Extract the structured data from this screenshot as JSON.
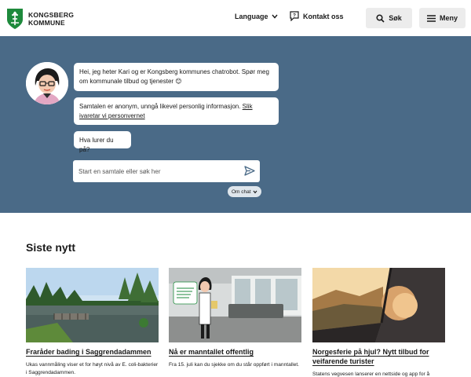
{
  "header": {
    "logo_line1": "KONGSBERG",
    "logo_line2": "KOMMUNE",
    "language": "Language",
    "contact": "Kontakt oss",
    "search": "Søk",
    "menu": "Meny"
  },
  "chat": {
    "bubble1": "Hei, jeg heter Kari og er Kongsberg kommunes chatrobot. Spør meg om kommunale tilbud og tjenester 😊",
    "bubble2_text": "Samtalen er anonym, unngå likevel personlig informasjon. ",
    "bubble2_link": "Slik ivaretar vi personvernet",
    "bubble3": "Hva lurer du på?",
    "input_placeholder": "Start en samtale eller søk her",
    "about": "Om chat"
  },
  "news": {
    "heading": "Siste nytt",
    "cards": [
      {
        "title": "Fraråder bading i Saggrendadammen",
        "text": "Ukas vannmåling viser et for høyt nivå av E. coli-bakterier i Saggrendadammen."
      },
      {
        "title": "Nå er manntallet offentlig",
        "text": "Fra 15. juli kan du sjekke om du står oppført i manntallet."
      },
      {
        "title": "Norgesferie på hjul? Nytt tilbud for veifarende turister",
        "text": "Statens vegvesen lanserer en nettside og app for å"
      }
    ]
  },
  "colors": {
    "hero_bg": "#4a6a87",
    "logo_green": "#1e8a3c"
  }
}
